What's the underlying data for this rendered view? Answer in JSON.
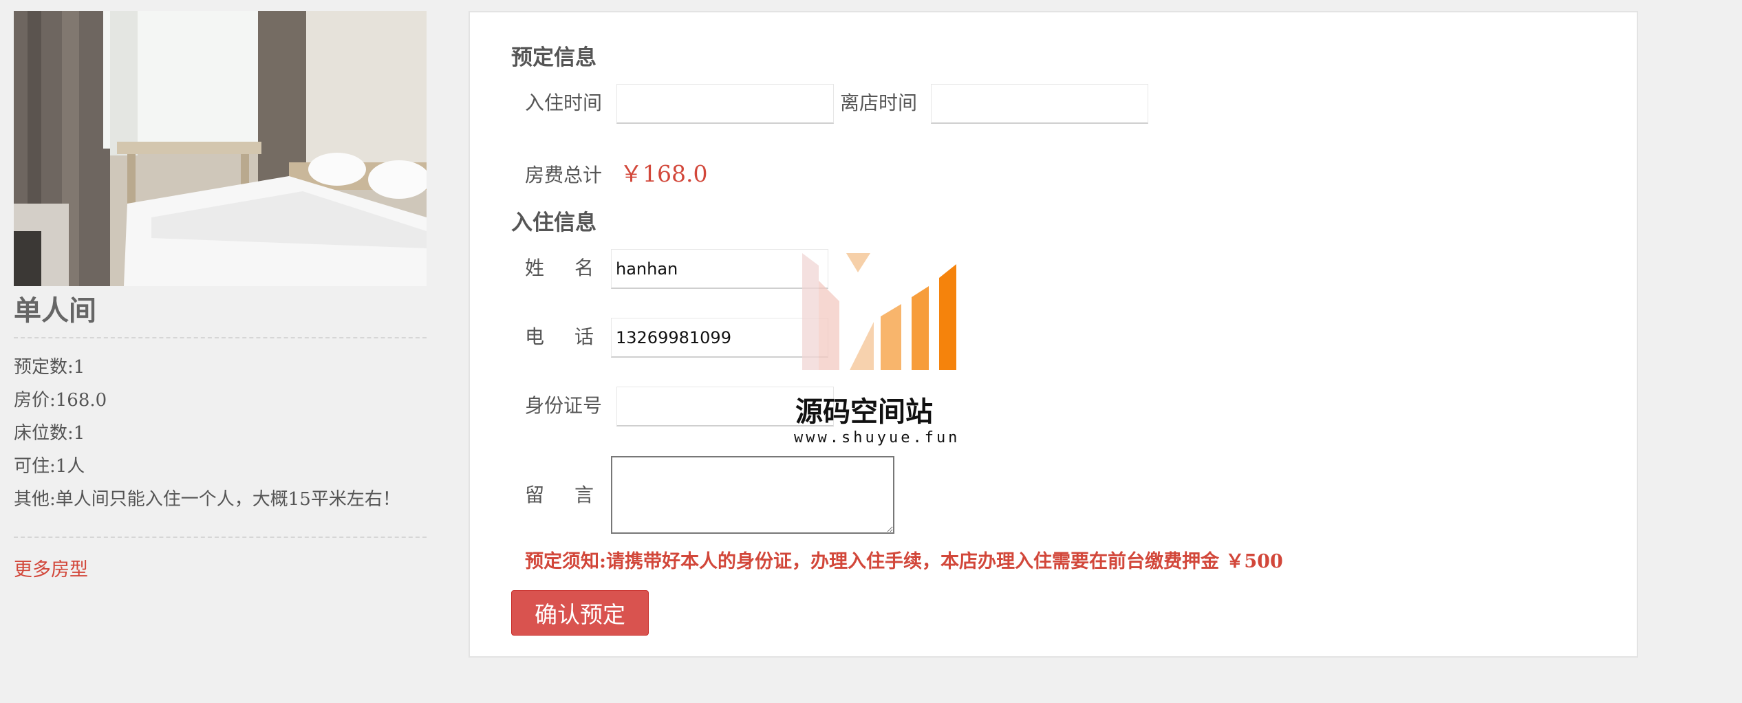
{
  "room": {
    "name": "单人间",
    "details": [
      "预定数:1",
      "房价:168.0",
      "床位数:1",
      "可住:1人",
      "其他:单人间只能入住一个人，大概15平米左右！"
    ],
    "more_link": "更多房型"
  },
  "booking": {
    "section_title": "预定信息",
    "checkin_label": "入住时间",
    "checkin_value": "",
    "checkout_label": "离店时间",
    "checkout_value": "",
    "total_label": "房费总计",
    "total_value": "￥168.0"
  },
  "guest": {
    "section_title": "入住信息",
    "name_label": "姓名",
    "name_value": "hanhan",
    "phone_label": "电话",
    "phone_value": "13269981099",
    "id_label": "身份证号",
    "id_value": "",
    "message_label": "留言",
    "message_value": ""
  },
  "notice": "预定须知:请携带好本人的身份证，办理入住手续，本店办理入住需要在前台缴费押金 ￥500",
  "confirm_button": "确认预定",
  "watermark": {
    "title": "源码空间站",
    "url": "www.shuyue.fun"
  },
  "colors": {
    "accent": "#d2473a",
    "button": "#d9534f",
    "background": "#f0f0f0"
  }
}
